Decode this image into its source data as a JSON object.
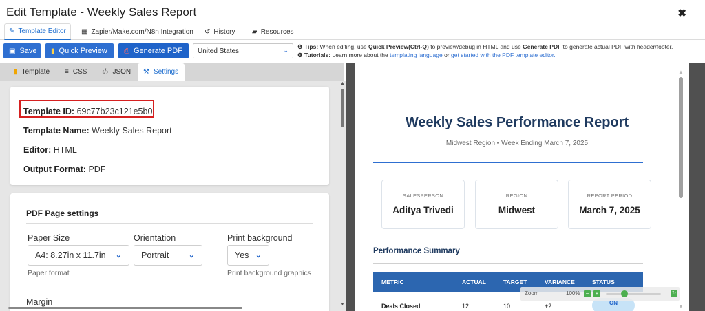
{
  "window": {
    "title": "Edit Template - Weekly Sales Report",
    "close_glyph": "✖"
  },
  "main_tabs": [
    {
      "label": "Template Editor",
      "icon": "pencil-icon",
      "glyph": "✎",
      "active": true
    },
    {
      "label": "Zapier/Make.com/N8n Integration",
      "icon": "grid-icon",
      "glyph": "▦"
    },
    {
      "label": "History",
      "icon": "history-icon",
      "glyph": "↺"
    },
    {
      "label": "Resources",
      "icon": "book-icon",
      "glyph": "▰"
    }
  ],
  "toolbar": {
    "save_label": "Save",
    "quick_preview_label": "Quick Preview",
    "generate_pdf_label": "Generate PDF",
    "country": "United States"
  },
  "tips": {
    "tips_label": "Tips:",
    "tips_a": "When editing, use",
    "tips_b": "Quick Preview(Ctrl-Q)",
    "tips_c": "to preview/debug in HTML and use",
    "tips_d": "Generate PDF",
    "tips_e": "to generate actual PDF with header/footer.",
    "tutorials_label": "Tutorials:",
    "tutorials_a": "Learn more about the",
    "link1": "templating language",
    "tutorials_b": "or",
    "link2": "get started with the PDF template editor."
  },
  "sub_tabs": [
    {
      "label": "Template",
      "icon": "template-icon",
      "glyph": "▮"
    },
    {
      "label": "CSS",
      "icon": "css-icon",
      "glyph": "≡"
    },
    {
      "label": "JSON",
      "icon": "code-icon",
      "glyph": "‹/›"
    },
    {
      "label": "Settings",
      "icon": "wrench-icon",
      "glyph": "⚒",
      "active": true
    }
  ],
  "template_info": {
    "id_label": "Template ID:",
    "id_value": "69c77b23c121e5b0",
    "name_label": "Template Name:",
    "name_value": "Weekly Sales Report",
    "editor_label": "Editor:",
    "editor_value": "HTML",
    "format_label": "Output Format:",
    "format_value": "PDF"
  },
  "pdf_settings": {
    "title": "PDF Page settings",
    "paper_size_label": "Paper Size",
    "paper_size_value": "A4: 8.27in x 11.7in",
    "paper_size_help": "Paper format",
    "orientation_label": "Orientation",
    "orientation_value": "Portrait",
    "print_bg_label": "Print background",
    "print_bg_value": "Yes",
    "print_bg_help": "Print background graphics",
    "margin_label": "Margin"
  },
  "preview": {
    "title": "Weekly Sales Performance Report",
    "subtitle": "Midwest Region • Week Ending March 7, 2025",
    "cards": [
      {
        "label": "SALESPERSON",
        "value": "Aditya Trivedi"
      },
      {
        "label": "REGION",
        "value": "Midwest"
      },
      {
        "label": "REPORT PERIOD",
        "value": "March 7, 2025"
      }
    ],
    "section_title": "Performance Summary",
    "columns": [
      "METRIC",
      "ACTUAL",
      "TARGET",
      "VARIANCE",
      "STATUS"
    ],
    "peek_row": [
      "Deals Closed",
      "12",
      "10",
      "+2"
    ],
    "status_pill": "ON"
  },
  "zoom": {
    "label": "Zoom",
    "value": "100%",
    "minus": "−",
    "plus": "+",
    "reset": "↻"
  },
  "colors": {
    "accent": "#2e6fd1",
    "highlight_box": "#d62020",
    "table_header": "#2c66b0",
    "heading": "#1f3a5f"
  }
}
